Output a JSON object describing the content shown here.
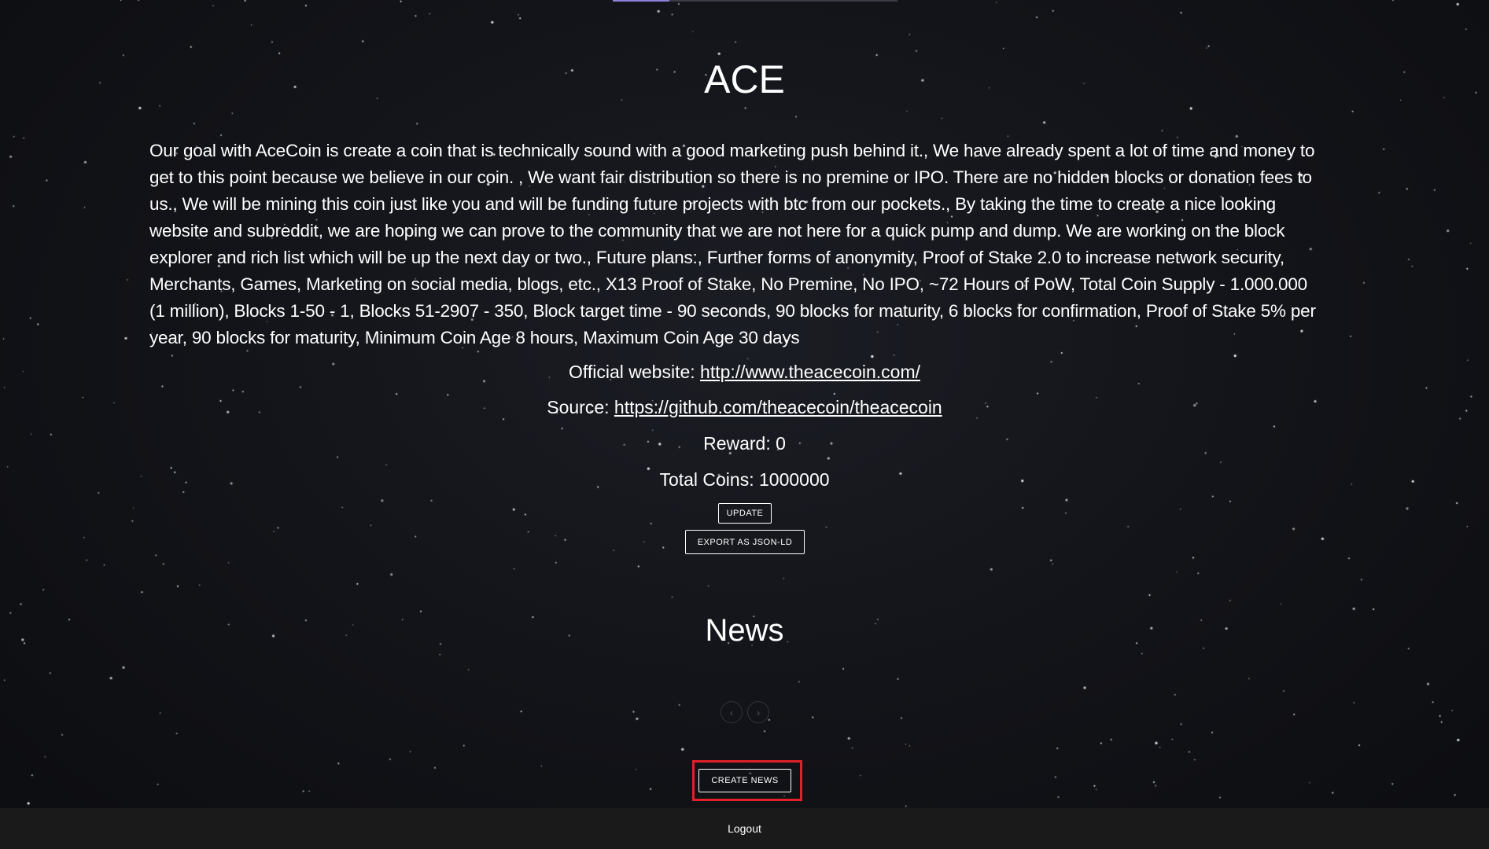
{
  "coin": {
    "title": "ACE",
    "description": "Our goal with AceCoin is create a coin that is technically sound with a good marketing push behind it., We have already spent a lot of time and money to get to this point because we believe in our coin. , We want fair distribution so there is no premine or IPO. There are no hidden blocks or donation fees to us., We will be mining this coin just like you and will be funding future projects with btc from our pockets., By taking the time to create a nice looking website and subreddit, we are hoping we can prove to the community that we are not here for a quick pump and dump. We are working on the block explorer and rich list which will be up the next day or two., Future plans:, Further forms of anonymity, Proof of Stake 2.0 to increase network security, Merchants, Games, Marketing on social media, blogs, etc., X13 Proof of Stake, No Premine, No IPO, ~72 Hours of PoW, Total Coin Supply - 1.000.000 (1 million), Blocks 1-50 - 1, Blocks 51-2907 - 350, Block target time - 90 seconds, 90 blocks for maturity, 6 blocks for confirmation, Proof of Stake 5% per year, 90 blocks for maturity, Minimum Coin Age 8 hours, Maximum Coin Age 30 days",
    "website_label": "Official website: ",
    "website_url": "http://www.theacecoin.com/",
    "source_label": "Source: ",
    "source_url": "https://github.com/theacecoin/theacecoin",
    "reward_text": "Reward: 0",
    "total_coins_text": "Total Coins: 1000000",
    "update_label": "UPDATE",
    "export_label": "EXPORT AS JSON-LD"
  },
  "news": {
    "title": "News",
    "prev_icon": "‹",
    "next_icon": "›",
    "create_label": "CREATE NEWS",
    "highlight_color": "#e0202a"
  },
  "footer": {
    "logout_label": "Logout"
  },
  "colors": {
    "background": "#121318",
    "footer": "#1a1a1a",
    "accent": "#8b7fd6"
  }
}
